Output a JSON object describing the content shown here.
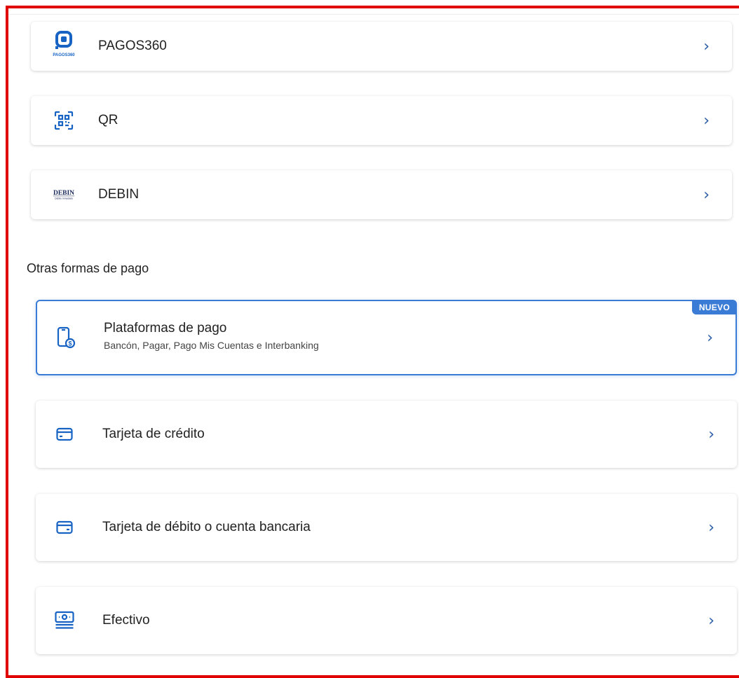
{
  "methods_top": [
    {
      "label": "PAGOS360",
      "icon": "pagos360-logo-icon",
      "logo_caption": "PAGOS360"
    },
    {
      "label": "QR",
      "icon": "qr-code-icon"
    },
    {
      "label": "DEBIN",
      "icon": "debin-logo-icon",
      "logo_text": "DEBIN",
      "logo_subtext": "Débito Inmediato"
    }
  ],
  "section_title": "Otras formas de pago",
  "methods_other": [
    {
      "title": "Plataformas de pago",
      "subtitle": "Bancón, Pagar, Pago Mis Cuentas e Interbanking",
      "badge": "NUEVO",
      "icon": "phone-payment-icon"
    },
    {
      "label": "Tarjeta de crédito",
      "icon": "credit-card-icon"
    },
    {
      "label": "Tarjeta de débito o cuenta bancaria",
      "icon": "debit-card-icon"
    },
    {
      "label": "Efectivo",
      "icon": "cash-icon"
    }
  ],
  "chevron": "›",
  "colors": {
    "accent": "#3a7bd5",
    "frame": "#e00000"
  }
}
